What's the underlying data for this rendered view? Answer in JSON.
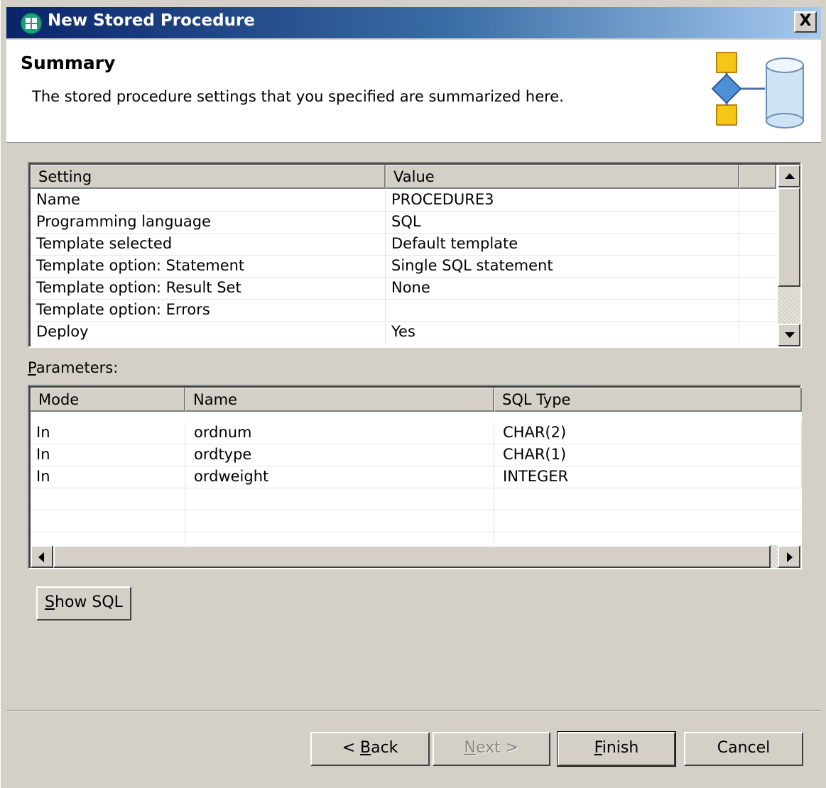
{
  "window": {
    "title": "New Stored Procedure",
    "close_label": "X"
  },
  "header": {
    "title": "Summary",
    "description": "The stored procedure settings that you specified are summarized here."
  },
  "summary_table": {
    "columns": [
      "Setting",
      "Value"
    ],
    "rows": [
      {
        "setting": "Name",
        "value": "PROCEDURE3"
      },
      {
        "setting": "Programming language",
        "value": "SQL"
      },
      {
        "setting": "Template selected",
        "value": "Default template"
      },
      {
        "setting": "Template option: Statement",
        "value": "Single SQL statement"
      },
      {
        "setting": "Template option: Result Set",
        "value": "None"
      },
      {
        "setting": "Template option: Errors",
        "value": ""
      },
      {
        "setting": "Deploy",
        "value": "Yes"
      }
    ]
  },
  "parameters": {
    "label_prefix": "",
    "label_mnemonic": "P",
    "label_rest": "arameters:",
    "columns": [
      "Mode",
      "Name",
      "SQL Type"
    ],
    "rows": [
      {
        "mode": "In",
        "name": "ordnum",
        "sql_type": "CHAR(2)"
      },
      {
        "mode": "In",
        "name": "ordtype",
        "sql_type": "CHAR(1)"
      },
      {
        "mode": "In",
        "name": "ordweight",
        "sql_type": "INTEGER"
      }
    ]
  },
  "buttons": {
    "show_sql": {
      "mnemonic": "S",
      "rest": "how SQL"
    },
    "back": {
      "prefix": "< ",
      "mnemonic": "B",
      "rest": "ack"
    },
    "next": {
      "prefix": "",
      "mnemonic": "N",
      "rest": "ext >"
    },
    "finish": {
      "prefix": "",
      "mnemonic": "F",
      "rest": "inish"
    },
    "cancel": {
      "label": "Cancel"
    }
  }
}
